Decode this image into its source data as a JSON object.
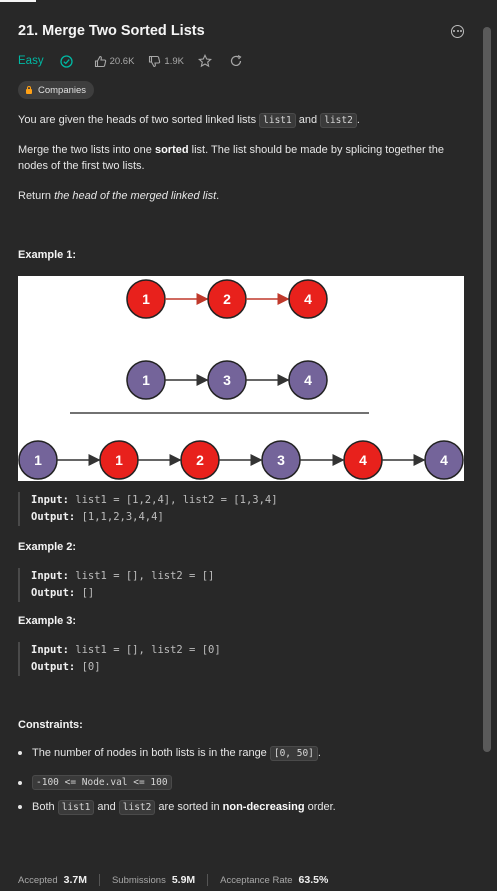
{
  "problem": {
    "title": "21. Merge Two Sorted Lists",
    "difficulty": "Easy",
    "likes": "20.6K",
    "dislikes": "1.9K",
    "companies_label": "Companies"
  },
  "description": {
    "p1_a": "You are given the heads of two sorted linked lists ",
    "p1_code1": "list1",
    "p1_b": " and ",
    "p1_code2": "list2",
    "p1_c": ".",
    "p2_a": "Merge the two lists into one ",
    "p2_bold": "sorted",
    "p2_b": " list. The list should be made by splicing together the nodes of the first two lists.",
    "p3_a": "Return ",
    "p3_italic": "the head of the merged linked list",
    "p3_b": "."
  },
  "diagram": {
    "list1": [
      "1",
      "2",
      "4"
    ],
    "list2": [
      "1",
      "3",
      "4"
    ],
    "merged": [
      "1",
      "1",
      "2",
      "3",
      "4",
      "4"
    ]
  },
  "examples": [
    {
      "title": "Example 1:",
      "input_label": "Input:",
      "input": "list1 = [1,2,4], list2 = [1,3,4]",
      "output_label": "Output:",
      "output": "[1,1,2,3,4,4]"
    },
    {
      "title": "Example 2:",
      "input_label": "Input:",
      "input": "list1 = [], list2 = []",
      "output_label": "Output:",
      "output": "[]"
    },
    {
      "title": "Example 3:",
      "input_label": "Input:",
      "input": "list1 = [], list2 = [0]",
      "output_label": "Output:",
      "output": "[0]"
    }
  ],
  "constraints": {
    "title": "Constraints:",
    "c1_a": "The number of nodes in both lists is in the range ",
    "c1_code": "[0, 50]",
    "c1_b": ".",
    "c2_code": "-100 <= Node.val <= 100",
    "c3_a": "Both ",
    "c3_code1": "list1",
    "c3_b": " and ",
    "c3_code2": "list2",
    "c3_c": " are sorted in ",
    "c3_bold": "non-decreasing",
    "c3_d": " order."
  },
  "stats": {
    "accepted_label": "Accepted",
    "accepted": "3.7M",
    "submissions_label": "Submissions",
    "submissions": "5.9M",
    "rate_label": "Acceptance Rate",
    "rate": "63.5%"
  },
  "colors": {
    "easy": "#00b8a3",
    "red_node": "#e8211c",
    "purple_node": "#74649a"
  }
}
